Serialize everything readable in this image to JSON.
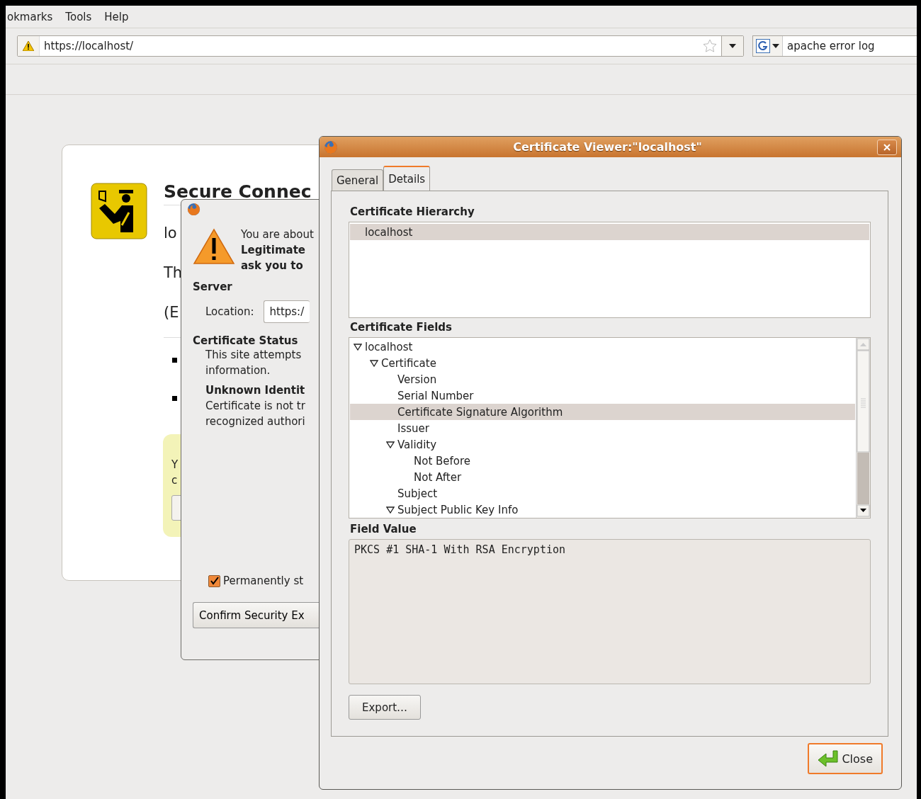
{
  "menu_bar": {
    "items": [
      "okmarks",
      "Tools",
      "Help"
    ]
  },
  "nav_bar": {
    "url": "https://localhost/",
    "search": "apache error log"
  },
  "error_page": {
    "title": "Secure Connec",
    "paragraphs": [
      "lo",
      "Th",
      "(E"
    ],
    "notice_lines": [
      "Y",
      "c"
    ]
  },
  "exception_dialog": {
    "intro": "You are about",
    "warning_lines": [
      "Legitimate",
      "ask you to"
    ],
    "server_heading": "Server",
    "location_label": "Location:",
    "location_value": "https:/",
    "status_heading": "Certificate Status",
    "status_lines": [
      "This site attempts",
      "information."
    ],
    "issue_heading": "Unknown Identit",
    "issue_lines": [
      "Certificate is not tr",
      "recognized authori"
    ],
    "permanent": {
      "label": "Permanently st",
      "checked": true
    },
    "confirm_button": "Confirm Security Ex"
  },
  "certificate_viewer": {
    "title": "Certificate Viewer:\"localhost\"",
    "tabs": [
      {
        "label": "General",
        "selected": false
      },
      {
        "label": "Details",
        "selected": true
      }
    ],
    "hierarchy_heading": "Certificate Hierarchy",
    "hierarchy": [
      {
        "label": "localhost",
        "selected": true
      }
    ],
    "fields_heading": "Certificate Fields",
    "fields": [
      {
        "kind": "group",
        "label": "localhost",
        "expanded": true,
        "selected": false,
        "children": [
          {
            "kind": "group",
            "label": "Certificate",
            "expanded": true,
            "selected": false,
            "children": [
              {
                "kind": "leaf",
                "label": "Version",
                "selected": false
              },
              {
                "kind": "leaf",
                "label": "Serial Number",
                "selected": false
              },
              {
                "kind": "leaf",
                "label": "Certificate Signature Algorithm",
                "selected": true
              },
              {
                "kind": "leaf",
                "label": "Issuer",
                "selected": false
              },
              {
                "kind": "group",
                "label": "Validity",
                "expanded": true,
                "selected": false,
                "children": [
                  {
                    "kind": "leaf",
                    "label": "Not Before",
                    "selected": false
                  },
                  {
                    "kind": "leaf",
                    "label": "Not After",
                    "selected": false
                  }
                ]
              },
              {
                "kind": "leaf",
                "label": "Subject",
                "selected": false
              },
              {
                "kind": "group",
                "label": "Subject Public Key Info",
                "expanded": true,
                "selected": false
              }
            ]
          }
        ]
      }
    ],
    "value_heading": "Field Value",
    "value": "PKCS #1 SHA-1 With RSA Encryption",
    "export_button": "Export…",
    "close_button": "Close"
  }
}
